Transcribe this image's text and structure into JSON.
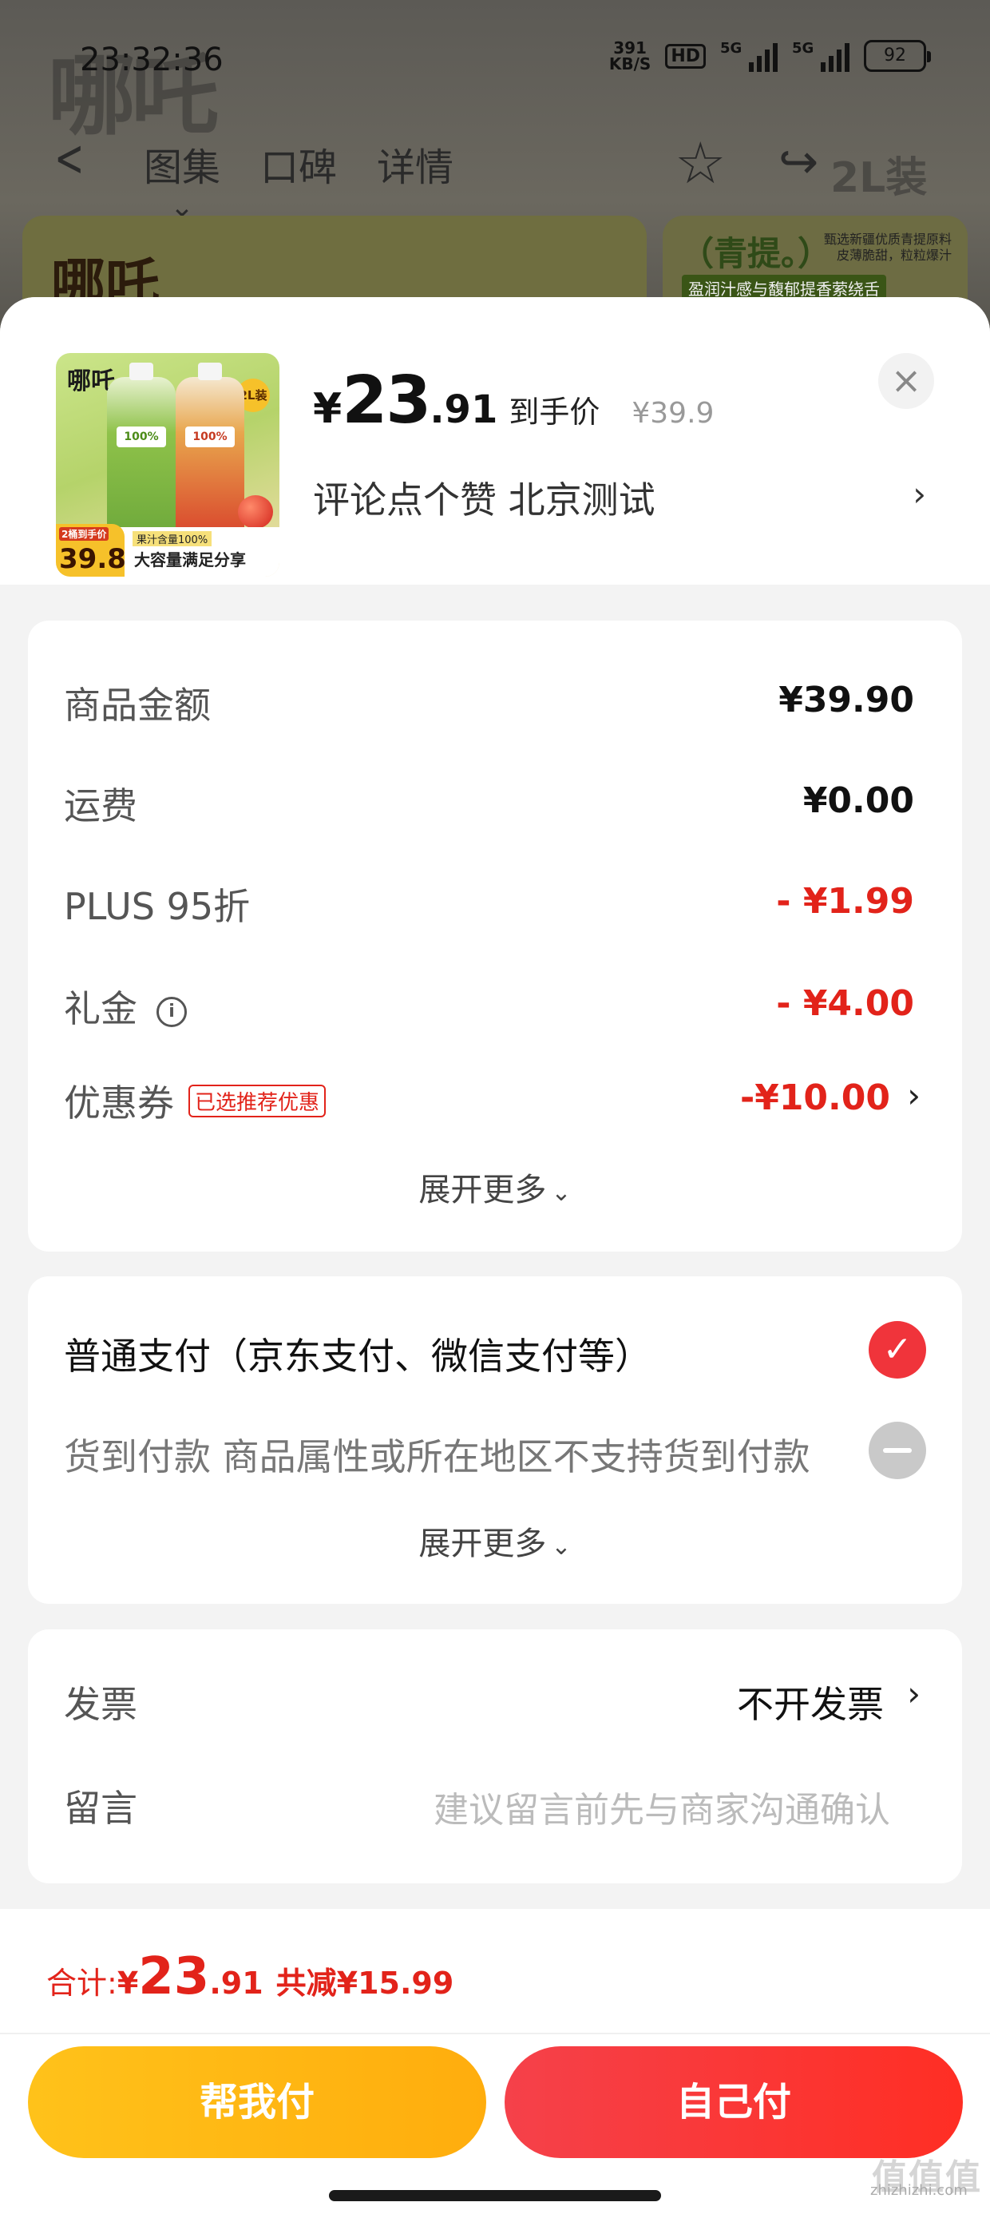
{
  "status_bar": {
    "time": "23:32:36",
    "net_speed_value": "391",
    "net_speed_unit": "KB/S",
    "hd_label": "HD",
    "signal1_label": "5G",
    "signal2_label": "5G",
    "battery": "92"
  },
  "background_page": {
    "brand_watermark": "哪吒",
    "tabs": [
      "图集",
      "口碑",
      "详情"
    ],
    "active_tab": "图集",
    "size_text": "2L装",
    "banner_logo": "哪吒",
    "banner_right_title": "（青提。）",
    "banner_right_small": "甄选新疆优质青提原料 皮薄脆甜，粒粒爆汁",
    "banner_right_tag": "盈润汁感与馥郁提香萦绕舌"
  },
  "product": {
    "thumb_logo": "哪吒",
    "thumb_size_badge": "2L装",
    "bottle1_label": "100%",
    "bottle2_label": "100%",
    "thumb_price_tag": "2桶到手价",
    "thumb_price": "39.8",
    "thumb_juice": "果汁含量100%",
    "thumb_caption": "大容量满足分享",
    "price_yen": "¥",
    "price_int": "23",
    "price_dec": ".91",
    "price_label": "到手价",
    "original_price": "¥39.9",
    "subtitle": "评论点个赞  北京测试"
  },
  "fees": {
    "rows": [
      {
        "label": "商品金额",
        "value": "¥39.90"
      },
      {
        "label": "运费",
        "value": "¥0.00"
      },
      {
        "label": "PLUS 95折",
        "value": "- ¥1.99"
      },
      {
        "label": "礼金",
        "value": "- ¥4.00"
      },
      {
        "label": "优惠券",
        "value": "-¥10.00",
        "tag": "已选推荐优惠"
      }
    ],
    "expand_label": "展开更多"
  },
  "payment": {
    "options": [
      {
        "label": "普通支付（京东支付、微信支付等）",
        "selected": true
      },
      {
        "label": "货到付款 商品属性或所在地区不支持货到付款",
        "selected": false
      }
    ],
    "expand_label": "展开更多"
  },
  "invoice": {
    "label": "发票",
    "value": "不开发票",
    "message_label": "留言",
    "message_placeholder": "建议留言前先与商家沟通确认"
  },
  "footer": {
    "total_label": "合计:",
    "total_yen": "¥",
    "total_int": "23",
    "total_dec": ".91",
    "total_saving": "共减¥15.99",
    "help_pay": "帮我付",
    "self_pay": "自己付"
  },
  "watermark": {
    "big": "值值值",
    "small": "zhizhizhi.com"
  },
  "colors": {
    "accent_red": "#e2231a",
    "help_button": "#ffb812",
    "self_button": "#f5414a"
  }
}
